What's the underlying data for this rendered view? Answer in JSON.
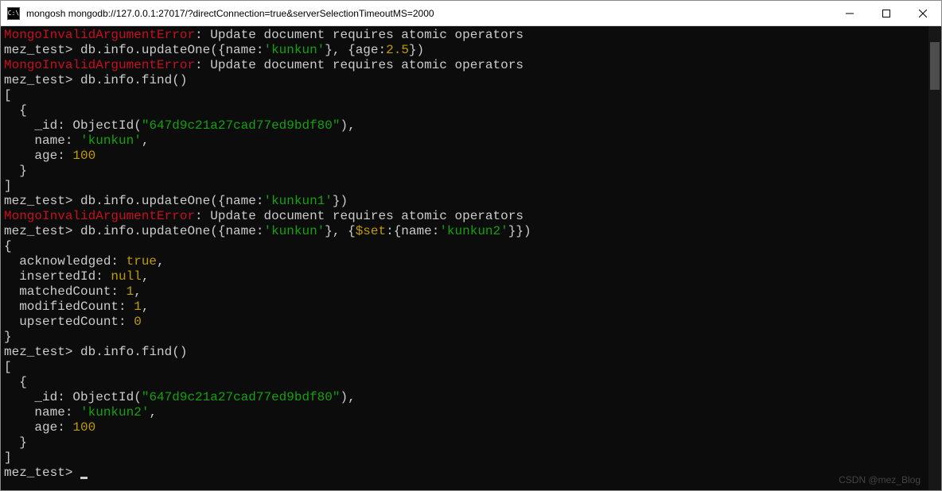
{
  "window": {
    "title": "mongosh mongodb://127.0.0.1:27017/?directConnection=true&serverSelectionTimeoutMS=2000",
    "icon_label": "cmd"
  },
  "terminal": {
    "error_prefix": "MongoInvalidArgumentError",
    "error_msg": ": Update document requires atomic operators",
    "prompt": "mez_test>",
    "cmd1_a": " db.info.updateOne({",
    "cmd1_b": "name",
    "cmd1_c": ":",
    "cmd1_d": "'kunkun'",
    "cmd1_e": "}, {",
    "cmd1_f": "age",
    "cmd1_g": ":",
    "cmd1_h": "2.5",
    "cmd1_i": "})",
    "cmd2": " db.info.find()",
    "arr_open": "[",
    "obj_open": "  {",
    "id_key": "    _id: ",
    "id_fn": "ObjectId(",
    "id_val": "\"647d9c21a27cad77ed9bdf80\"",
    "id_close": "),",
    "name_key": "    name: ",
    "name_val1": "'kunkun'",
    "name_val2": "'kunkun2'",
    "comma": ",",
    "age_key": "    age: ",
    "age_val": "100",
    "obj_close": "  }",
    "arr_close": "]",
    "cmd3_a": " db.info.updateOne({",
    "cmd3_b": "name",
    "cmd3_c": ":",
    "cmd3_d": "'kunkun1'",
    "cmd3_e": "})",
    "cmd4_a": " db.info.updateOne({",
    "cmd4_b": "name",
    "cmd4_c": ":",
    "cmd4_d": "'kunkun'",
    "cmd4_e": "}, {",
    "cmd4_f": "$set",
    "cmd4_g": ":{",
    "cmd4_h": "name",
    "cmd4_i": ":",
    "cmd4_j": "'kunkun2'",
    "cmd4_k": "}})",
    "res_open": "{",
    "ack_key": "  acknowledged: ",
    "ack_val": "true",
    "ins_key": "  insertedId: ",
    "ins_val": "null",
    "match_key": "  matchedCount: ",
    "match_val": "1",
    "mod_key": "  modifiedCount: ",
    "mod_val": "1",
    "ups_key": "  upsertedCount: ",
    "ups_val": "0",
    "res_close": "}",
    "final_prompt_space": " "
  },
  "watermark": "CSDN @mez_Blog"
}
